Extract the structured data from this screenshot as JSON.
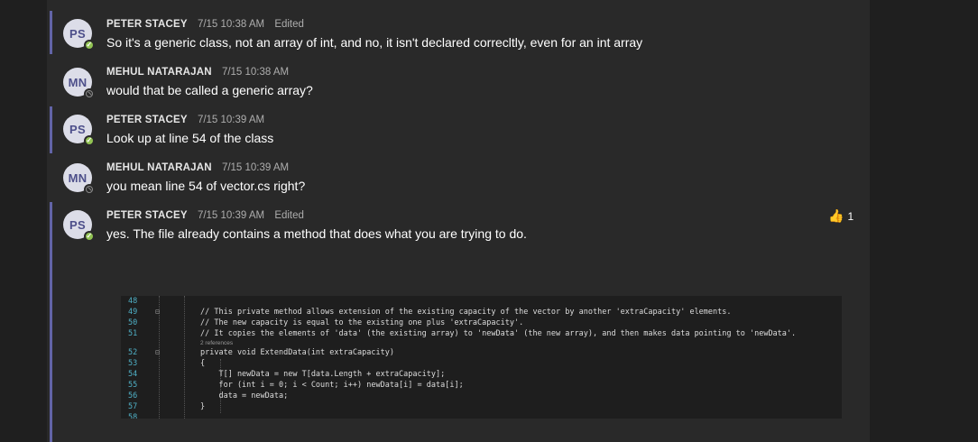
{
  "messages": [
    {
      "initials": "PS",
      "author": "PETER STACEY",
      "time": "7/15 10:38 AM",
      "edited": "Edited",
      "text": "So it's a generic class, not an array of int, and no, it isn't declared correcltly, even for an int array",
      "status": "available"
    },
    {
      "initials": "MN",
      "author": "MEHUL NATARAJAN",
      "time": "7/15 10:38 AM",
      "edited": "",
      "text": "would that be called a generic array?",
      "status": "offline"
    },
    {
      "initials": "PS",
      "author": "PETER STACEY",
      "time": "7/15 10:39 AM",
      "edited": "",
      "text": "Look up at line 54 of the class",
      "status": "available"
    },
    {
      "initials": "MN",
      "author": "MEHUL NATARAJAN",
      "time": "7/15 10:39 AM",
      "edited": "",
      "text": "you mean line 54 of vector.cs right?",
      "status": "offline"
    },
    {
      "initials": "PS",
      "author": "PETER STACEY",
      "time": "7/15 10:39 AM",
      "edited": "Edited",
      "text": "yes. The file already contains a method that does what you are trying to do.",
      "status": "available"
    }
  ],
  "reaction": {
    "emoji": "👍",
    "count": "1"
  },
  "code": {
    "line_numbers": [
      "48",
      "49",
      "50",
      "51",
      "52",
      "53",
      "54",
      "55",
      "56",
      "57",
      "58"
    ],
    "references": "2 references",
    "lines": [
      "",
      "// This private method allows extension of the existing capacity of the vector by another 'extraCapacity' elements.",
      "// The new capacity is equal to the existing one plus 'extraCapacity'.",
      "// It copies the elements of 'data' (the existing array) to 'newData' (the new array), and then makes data pointing to 'newData'.",
      "private void ExtendData(int extraCapacity)",
      "{",
      "    T[] newData = new T[data.Length + extraCapacity];",
      "    for (int i = 0; i < Count; i++) newData[i] = data[i];",
      "    data = newData;",
      "}",
      ""
    ]
  },
  "colors": {
    "accent": "#6264a7",
    "available": "#92c353",
    "background": "#292929"
  }
}
